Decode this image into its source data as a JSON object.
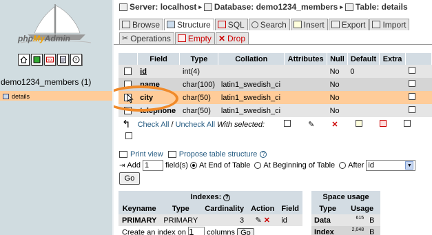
{
  "sidebar": {
    "logo_php": "php",
    "logo_my": "My",
    "logo_admin": "Admin",
    "db_title": "demo1234_members (1)",
    "table_item": "details"
  },
  "breadcrumb": {
    "server": "Server: localhost",
    "sep1": "▸",
    "database": "Database: demo1234_members",
    "sep2": "▸",
    "table": "Table: details"
  },
  "tabs": [
    {
      "label": "Browse"
    },
    {
      "label": "Structure"
    },
    {
      "label": "SQL"
    },
    {
      "label": "Search"
    },
    {
      "label": "Insert"
    },
    {
      "label": "Export"
    },
    {
      "label": "Import"
    }
  ],
  "tabs2": [
    {
      "label": "Operations"
    },
    {
      "label": "Empty"
    },
    {
      "label": "Drop"
    }
  ],
  "structure": {
    "headers": [
      "Field",
      "Type",
      "Collation",
      "Attributes",
      "Null",
      "Default",
      "Extra"
    ],
    "rows": [
      {
        "field": "id",
        "type": "int(4)",
        "collation": "",
        "attributes": "",
        "null": "No",
        "default": "0",
        "extra": ""
      },
      {
        "field": "name",
        "type": "char(100)",
        "collation": "latin1_swedish_ci",
        "attributes": "",
        "null": "No",
        "default": "",
        "extra": ""
      },
      {
        "field": "city",
        "type": "char(50)",
        "collation": "latin1_swedish_ci",
        "attributes": "",
        "null": "No",
        "default": "",
        "extra": ""
      },
      {
        "field": "telephone",
        "type": "char(50)",
        "collation": "latin1_swedish_ci",
        "attributes": "",
        "null": "No",
        "default": "",
        "extra": ""
      }
    ]
  },
  "checkall": {
    "check_all": "Check All",
    "slash": " / ",
    "uncheck_all": "Uncheck All",
    "with_selected": "With selected:"
  },
  "links": {
    "print_view": "Print view",
    "propose": "Propose table structure"
  },
  "addfield": {
    "add": "Add",
    "count": "1",
    "fields": "field(s)",
    "at_end": "At End of Table",
    "at_begin": "At Beginning of Table",
    "after": "After",
    "after_select": "id",
    "go": "Go"
  },
  "indexes": {
    "title": "Indexes:",
    "headers": [
      "Keyname",
      "Type",
      "Cardinality",
      "Action",
      "Field"
    ],
    "row": {
      "keyname": "PRIMARY",
      "type": "PRIMARY",
      "cardinality": "3",
      "field": "id"
    },
    "create_prefix": "Create an index on",
    "create_count": "1",
    "create_suffix": "columns",
    "go": "Go"
  },
  "space": {
    "title": "Space usage",
    "headers": [
      "Type",
      "Usage"
    ],
    "rows": [
      {
        "type": "Data",
        "usage": "615",
        "unit": "B"
      },
      {
        "type": "Index",
        "usage": "2,048",
        "unit": "B"
      }
    ]
  },
  "colors": {
    "sidebar_bg": "#d0dce0",
    "highlight": "#ffcc99",
    "annotation_circle": "#f08a2a",
    "header_bg": "#d3dce3",
    "link": "#235a81"
  }
}
